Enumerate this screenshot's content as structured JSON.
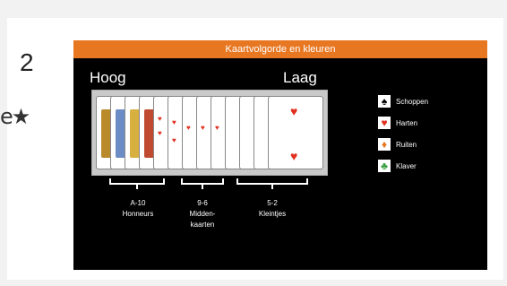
{
  "rank": "2",
  "rating_fragment": "e★",
  "thumbnail": {
    "title": "Kaartvolgorde en kleuren",
    "high_label": "Hoog",
    "low_label": "Laag",
    "groups": [
      {
        "range": "A-10",
        "name": "Honneurs"
      },
      {
        "range": "9-6",
        "name": "Midden-\nkaarten"
      },
      {
        "range": "5-2",
        "name": "Kleintjes"
      }
    ],
    "legend": [
      {
        "label": "Schoppen",
        "icon": "spade-icon",
        "symbol": "♠",
        "color": "#000000"
      },
      {
        "label": "Harten",
        "icon": "heart-icon",
        "symbol": "♥",
        "color": "#e03020"
      },
      {
        "label": "Ruiten",
        "icon": "diamond-icon",
        "symbol": "♦",
        "color": "#e87722"
      },
      {
        "label": "Klaver",
        "icon": "club-icon",
        "symbol": "♣",
        "color": "#3aa040"
      }
    ],
    "colors": {
      "banner": "#e87722",
      "background": "#000000"
    }
  }
}
